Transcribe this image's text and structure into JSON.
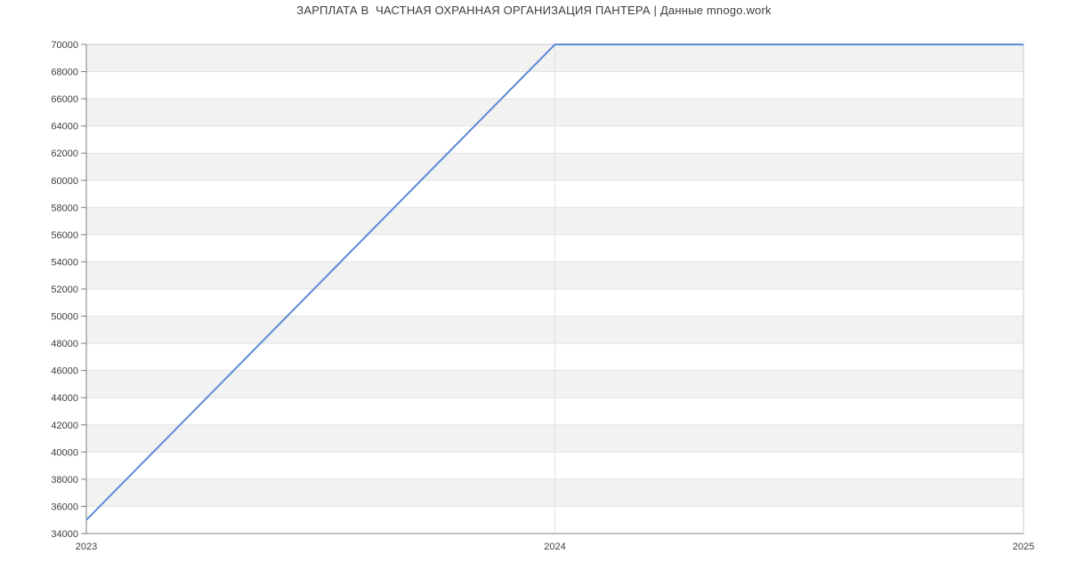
{
  "chart_data": {
    "type": "line",
    "title": "ЗАРПЛАТА В  ЧАСТНАЯ ОХРАННАЯ ОРГАНИЗАЦИЯ ПАНТЕРА | Данные mnogo.work",
    "categories": [
      "2023",
      "2024",
      "2025"
    ],
    "values": [
      35000,
      70000,
      70000
    ],
    "xlabel": "",
    "ylabel": "",
    "ylim": [
      34000,
      70000
    ],
    "ytick_step": 2000,
    "grid": true,
    "legend": "none",
    "band_alternating": true,
    "colors": {
      "line": "#5b8bd8",
      "band": "#f2f2f2",
      "gridline": "#e3e3e3",
      "border": "#c9c9c9",
      "axis": "#7f7f7f",
      "tick_label": "#3f3f3f",
      "title": "#3d3d3d"
    }
  }
}
